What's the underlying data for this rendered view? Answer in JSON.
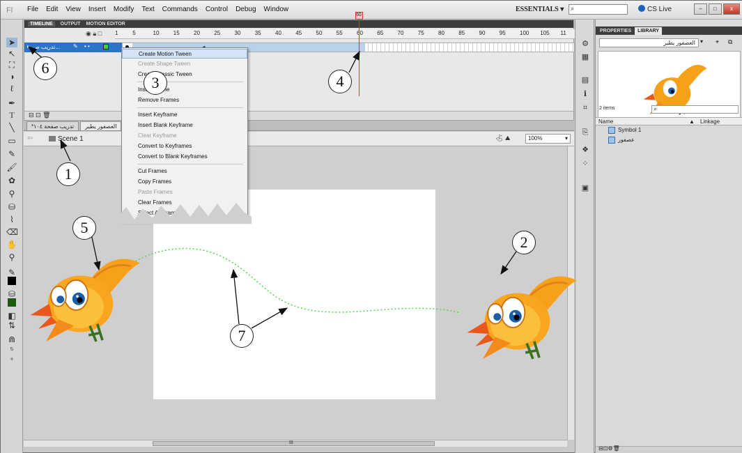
{
  "menubar": {
    "logo": "Fl",
    "items": [
      "File",
      "Edit",
      "View",
      "Insert",
      "Modify",
      "Text",
      "Commands",
      "Control",
      "Debug",
      "Window"
    ],
    "workspace": "ESSENTIALS ▾",
    "cs_live": "CS Live",
    "window_controls": [
      "–",
      "□",
      "x"
    ]
  },
  "timeline": {
    "tabs": [
      "TIMELINE",
      "OUTPUT",
      "MOTION EDITOR"
    ],
    "layer_name": "...تدريب ص",
    "frame_ticks": [
      "1",
      "5",
      "10",
      "15",
      "20",
      "25",
      "30",
      "35",
      "40",
      "45",
      "50",
      "55",
      "60",
      "65",
      "70",
      "75",
      "80",
      "85",
      "90",
      "95",
      "100",
      "105",
      "11"
    ],
    "current_frame_label": "60"
  },
  "context_menu": {
    "items": [
      {
        "label": "Create Motion Tween",
        "state": "highlighted"
      },
      {
        "label": "Create Shape Tween",
        "state": "disabled"
      },
      {
        "label": "Create Classic Tween",
        "state": "enabled"
      },
      {
        "label": "Insert Frame",
        "state": "enabled"
      },
      {
        "label": "Remove Frames",
        "state": "enabled"
      },
      {
        "label": "Insert Keyframe",
        "state": "enabled"
      },
      {
        "label": "Insert Blank Keyframe",
        "state": "enabled"
      },
      {
        "label": "Clear Keyframe",
        "state": "disabled"
      },
      {
        "label": "Convert to Keyframes",
        "state": "enabled"
      },
      {
        "label": "Convert to Blank Keyframes",
        "state": "enabled"
      },
      {
        "label": "Cut Frames",
        "state": "enabled"
      },
      {
        "label": "Copy Frames",
        "state": "enabled"
      },
      {
        "label": "Paste Frames",
        "state": "disabled"
      },
      {
        "label": "Clear Frames",
        "state": "enabled"
      },
      {
        "label": "Select All Frames",
        "state": "enabled"
      }
    ]
  },
  "doc_tabs": [
    "العصفور يطير",
    "تدريب صفحة ١٠٤*"
  ],
  "editbar": {
    "scene": "Scene 1",
    "zoom": "100%"
  },
  "library": {
    "tabs": [
      "PROPERTIES",
      "LIBRARY"
    ],
    "document": "العصفور يطير",
    "item_count": "2 items",
    "columns": {
      "name": "Name",
      "linkage": "Linkage"
    },
    "items": [
      "Symbol 1",
      "عصفور"
    ]
  },
  "callouts": [
    "1",
    "2",
    "3",
    "4",
    "5",
    "6",
    "7"
  ],
  "colors": {
    "accent": "#2d73c7",
    "playhead": "#e03030",
    "stage": "#ffffff",
    "path": "#4fd64f",
    "bird": "#f7a11a"
  },
  "hscroll_label": "III"
}
